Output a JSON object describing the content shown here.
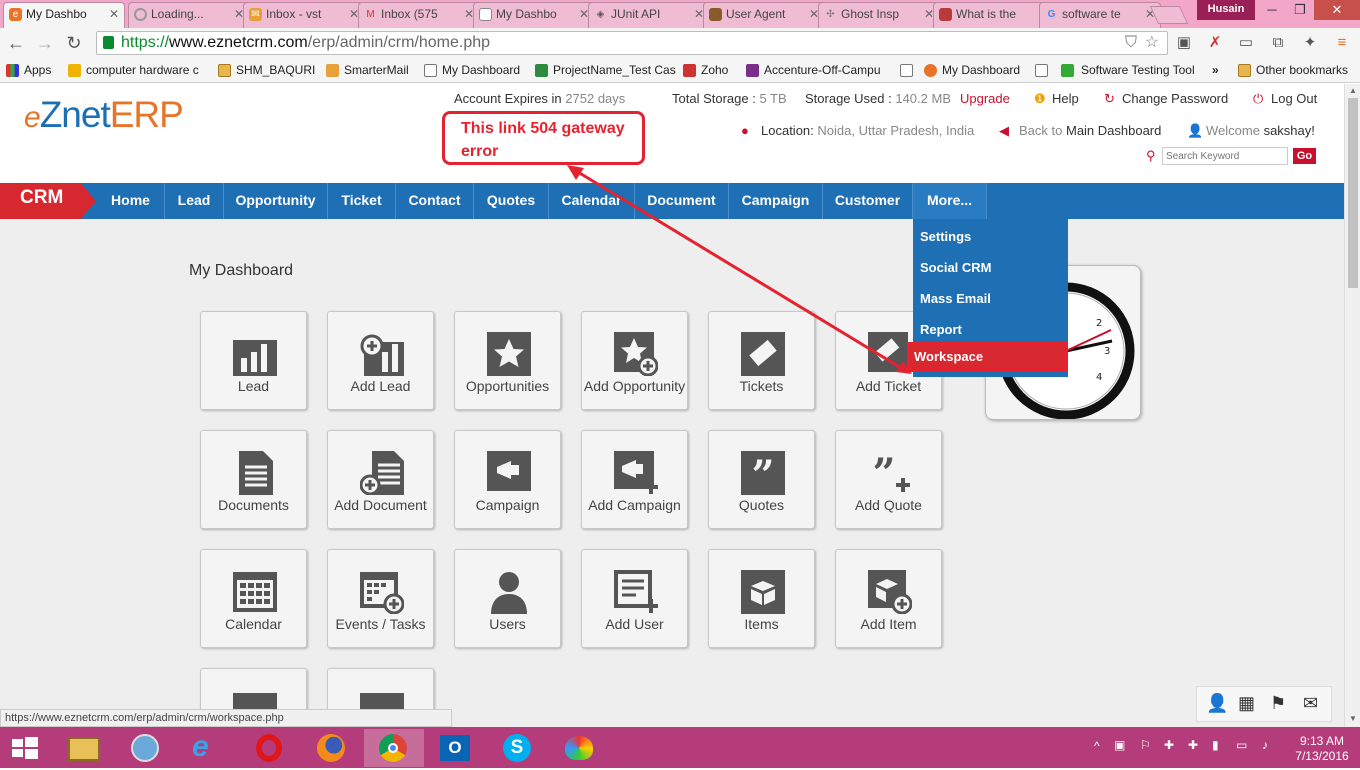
{
  "browser": {
    "tabs": [
      {
        "title": "My Dashbo",
        "active": true
      },
      {
        "title": "Loading..."
      },
      {
        "title": "Inbox - vst"
      },
      {
        "title": "Inbox (575"
      },
      {
        "title": "My Dashbo"
      },
      {
        "title": "JUnit API"
      },
      {
        "title": "User Agent"
      },
      {
        "title": "Ghost Insp"
      },
      {
        "title": "What is the"
      },
      {
        "title": "software te"
      }
    ],
    "profile_name": "Husain",
    "url_scheme": "https://",
    "url_host": "www.eznetcrm.com",
    "url_path": "/erp/admin/crm/home.php",
    "bookmarks": [
      "Apps",
      "computer hardware c",
      "SHM_BAQURI",
      "SmarterMail",
      "My Dashboard",
      "ProjectName_Test Cas",
      "Zoho",
      "Accenture-Off-Campu",
      "My Dashboard",
      "Software Testing Tool"
    ],
    "bookmarks_overflow": "»",
    "other_bookmarks": "Other bookmarks",
    "status_url": "https://www.eznetcrm.com/erp/admin/crm/workspace.php"
  },
  "header": {
    "logo_e": "e",
    "logo_znet": "Znet",
    "logo_erp": "ERP",
    "account_expires_label": "Account Expires in",
    "account_expires_value": "2752 days",
    "total_storage_label": "Total Storage :",
    "total_storage_value": "5 TB",
    "storage_used_label": "Storage Used :",
    "storage_used_value": "140.2 MB",
    "upgrade": "Upgrade",
    "help": "Help",
    "change_password": "Change Password",
    "logout": "Log Out",
    "location_label": "Location:",
    "location_value": "Noida, Uttar Pradesh, India",
    "back_prefix": "Back to",
    "back_target": "Main Dashboard",
    "welcome_prefix": "Welcome",
    "welcome_user": "sakshay!",
    "search_placeholder": "Search Keyword",
    "go": "Go"
  },
  "annotation": {
    "line1": "This link 504 gateway",
    "line2": "error"
  },
  "nav": {
    "module": "CRM",
    "items": [
      "Home",
      "Lead",
      "Opportunity",
      "Ticket",
      "Contact",
      "Quotes",
      "Calendar",
      "Document",
      "Campaign",
      "Customer",
      "More..."
    ]
  },
  "more_menu": [
    "Settings",
    "Social CRM",
    "Mass Email",
    "Report",
    "Workspace"
  ],
  "dashboard": {
    "title": "My Dashboard",
    "tiles": [
      "Lead",
      "Add Lead",
      "Opportunities",
      "Add Opportunity",
      "Tickets",
      "Add Ticket",
      "Documents",
      "Add Document",
      "Campaign",
      "Add Campaign",
      "Quotes",
      "Add Quote",
      "Calendar",
      "Events / Tasks",
      "Users",
      "Add User",
      "Items",
      "Add Item"
    ]
  },
  "taskbar": {
    "time": "9:13 AM",
    "date": "7/13/2016"
  },
  "colors": {
    "nav_blue": "#1e6fb4",
    "crm_red": "#d7282f",
    "annotation_red": "#e52330",
    "taskbar_pink": "#b53c7a"
  }
}
